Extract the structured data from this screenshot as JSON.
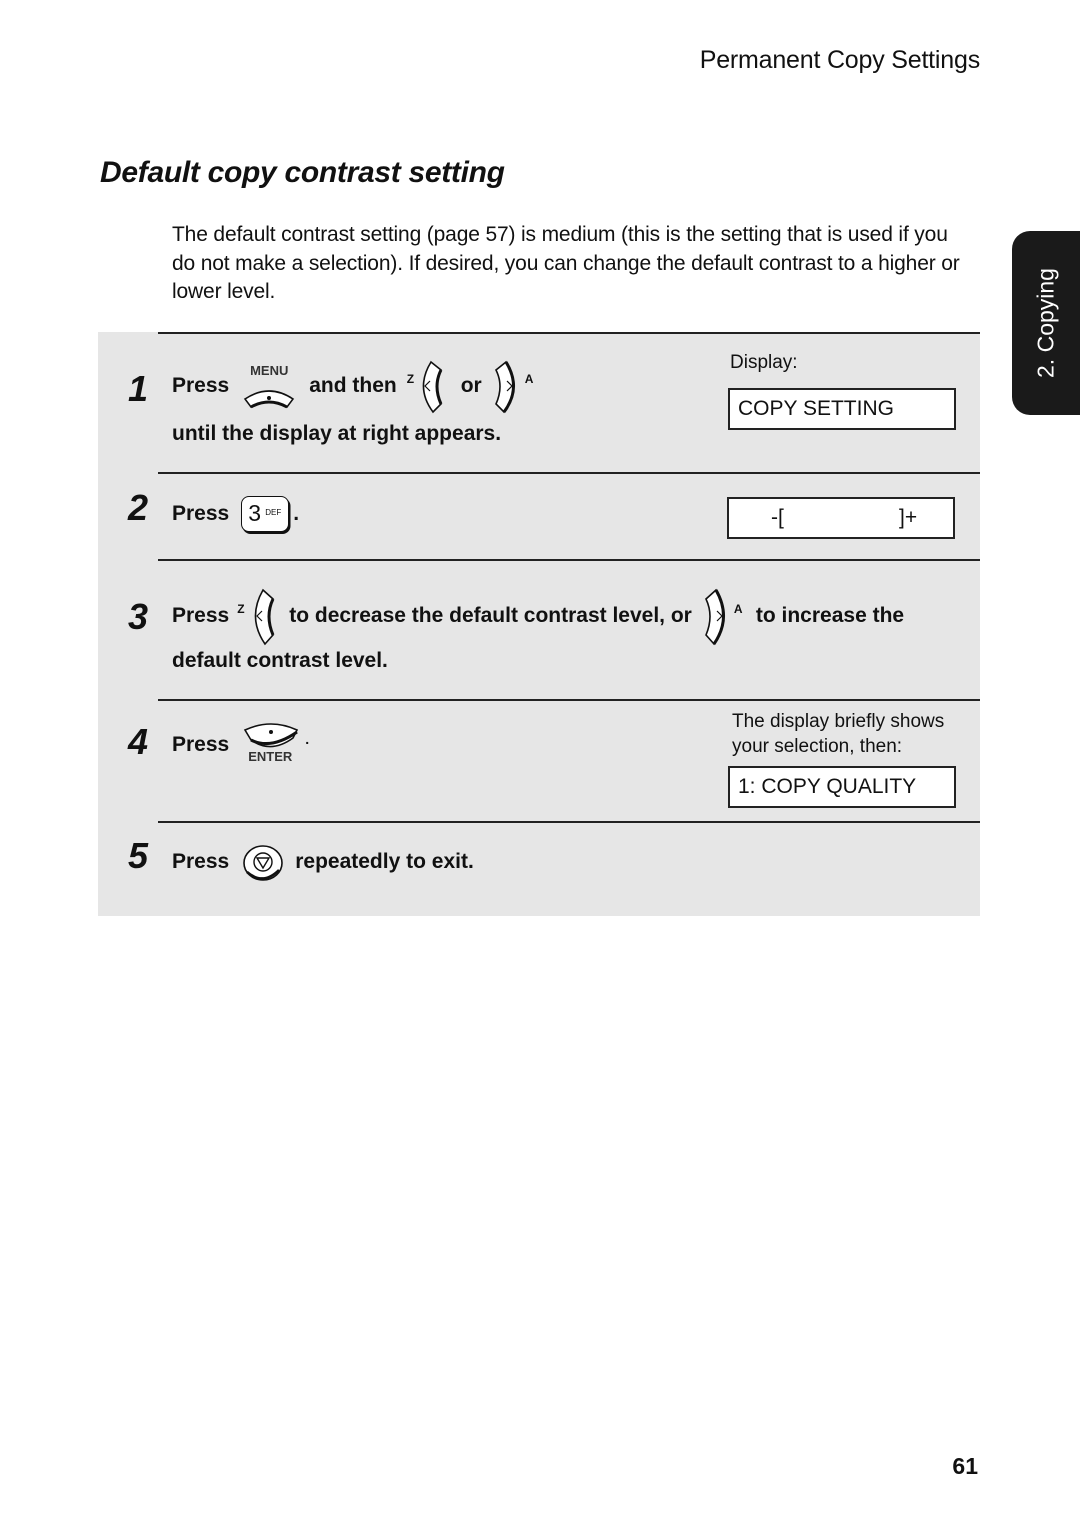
{
  "header": {
    "running_title": "Permanent Copy Settings"
  },
  "section": {
    "title": "Default copy contrast setting",
    "intro": "The default contrast setting (page 57) is medium (this is the setting that is used if you do not make a selection). If desired, you can change the default contrast to a higher or lower level."
  },
  "side_tab": {
    "label": "2. Copying",
    "color": "#1a1a1a"
  },
  "panel": {
    "background": "#e6e6e6"
  },
  "steps": [
    {
      "number": "1",
      "press": "Press",
      "menu_key_label": "MENU",
      "and_then": "and then",
      "left_key_letter": "Z",
      "or": "or",
      "right_key_letter": "A",
      "line2": "until the display at right appears.",
      "display_caption": "Display:",
      "display_text": "COPY SETTING"
    },
    {
      "number": "2",
      "press": "Press",
      "key_digit": "3",
      "key_letters": "DEF",
      "period": ".",
      "display_left": "-[",
      "display_right": "]+"
    },
    {
      "number": "3",
      "press": "Press",
      "left_key_letter": "Z",
      "text_mid": "to decrease the default contrast level, or",
      "right_key_letter": "A",
      "text_end": "to increase the",
      "line2": "default contrast level."
    },
    {
      "number": "4",
      "press": "Press",
      "enter_key_label": "ENTER",
      "period": ".",
      "caption_line1": "The display briefly shows",
      "caption_line2": "your selection, then:",
      "display_text": "1: COPY QUALITY"
    },
    {
      "number": "5",
      "press": "Press",
      "text_end": "repeatedly to exit."
    }
  ],
  "footer": {
    "page_number": "61"
  }
}
